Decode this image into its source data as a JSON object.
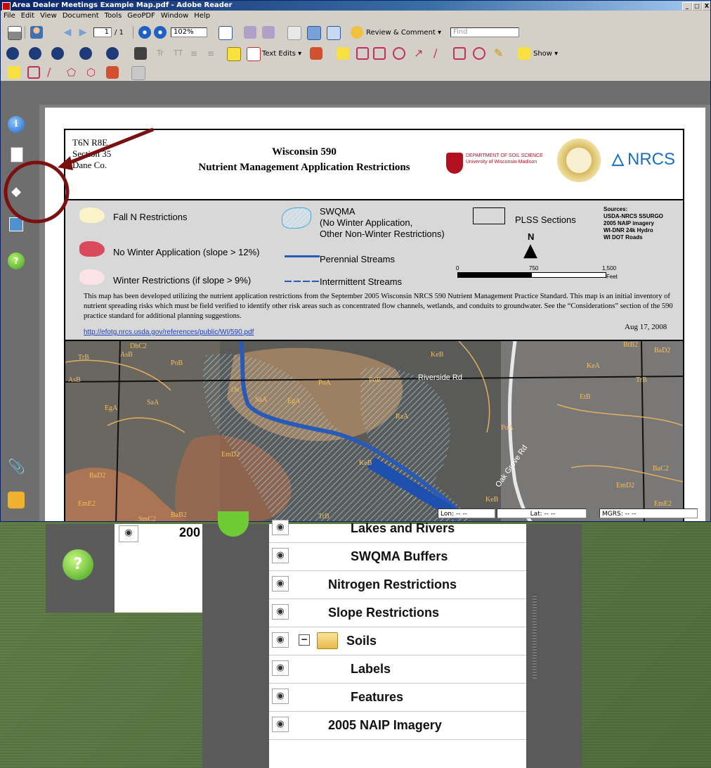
{
  "window": {
    "title": "Area Dealer Meetings Example Map.pdf - Adobe Reader",
    "controls": [
      "_",
      "□",
      "X"
    ]
  },
  "menu": [
    "File",
    "Edit",
    "View",
    "Document",
    "Tools",
    "GeoPDF",
    "Window",
    "Help"
  ],
  "toolbar": {
    "page_current": "1",
    "page_total": "/ 1",
    "zoom": "102%",
    "review_label": "Review & Comment ▾",
    "find_placeholder": "Find",
    "text_edits_label": "Text Edits ▾",
    "show_label": "Show ▾"
  },
  "map": {
    "location_line1": "T6N  R8E",
    "location_line2": "Section 35",
    "location_line3": "Dane Co.",
    "title_line1": "Wisconsin 590",
    "title_line2": "Nutrient Management Application Restrictions",
    "logo_uw": "DEPARTMENT OF SOIL SCIENCE University of Wisconsin-Madison",
    "logo_nrcs": "NRCS",
    "legend": {
      "fall_n": "Fall N Restrictions",
      "no_winter": "No Winter Application (slope > 12%)",
      "winter": "Winter Restrictions (if slope > 9%)",
      "swqma_1": "SWQMA",
      "swqma_2": "(No Winter Application,",
      "swqma_3": "Other Non-Winter Restrictions)",
      "perennial": "Perennial Streams",
      "intermittent": "Intermittent Streams",
      "plss": "PLSS Sections",
      "sources": [
        "Sources:",
        "USDA-NRCS SSURGO",
        "2005 NAIP imagery",
        "WI-DNR 24k Hydro",
        "WI DOT Roads"
      ],
      "north": "N",
      "scale": [
        "0",
        "750",
        "1,500"
      ],
      "scale_unit": "Feet"
    },
    "disclaimer": "This map has been developed utilizing the nutrient application restrictions from the September 2005 Wisconsin NRCS 590 Nutrient Management Practice Standard. This map is an initial inventory of nutrient spreading risks which must be field verified to identify other risk areas such as concentrated flow channels, wetlands, and conduits to groundwater. See the “Considerations” section of the 590 practice standard for additional planning suggestions.",
    "link": "http://efotg.nrcs.usda.gov/references/public/WI/590.pdf",
    "date": "Aug 17, 2008",
    "soil_labels": [
      "TrB",
      "AsB",
      "DbC2",
      "PoB",
      "AsB",
      "EgA",
      "SaA",
      "Os",
      "SaA",
      "EgA",
      "PoA",
      "PoB",
      "Riverside Rd",
      "KeB",
      "RaA",
      "PoA",
      "KeA",
      "BtB2",
      "BaD2",
      "TrB",
      "EtB",
      "BaC2",
      "EmD2",
      "KeB",
      "BaD2",
      "EmE2",
      "SmC2",
      "BaB2",
      "TrB",
      "KeB",
      "EmD2",
      "EmE2"
    ],
    "road_label": "Oak Grove Rd"
  },
  "status": {
    "lon": "Lon: -- --",
    "lat": "Lat: -- --",
    "mgrs": "MGRS: -- --"
  },
  "layers": {
    "partial_label": "200",
    "items": [
      "Lakes and Rivers",
      "SWQMA Buffers",
      "Nitrogen Restrictions",
      "Slope Restrictions",
      "Soils",
      "Labels",
      "Features",
      "2005 NAIP Imagery"
    ],
    "soils_toggle": "−"
  }
}
